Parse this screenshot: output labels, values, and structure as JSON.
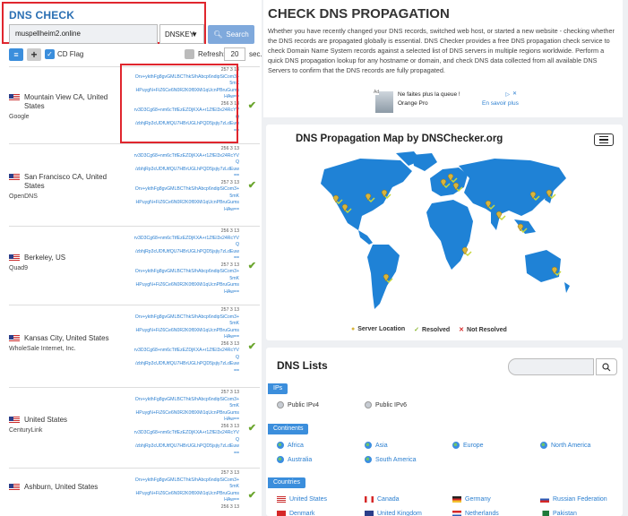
{
  "left": {
    "title": "DNS CHECK",
    "domain_value": "muspellheim2.online",
    "record_type": "DNSKEY",
    "search_label": "Search",
    "cd_flag_label": "CD Flag",
    "refresh_label": "Refresh:",
    "refresh_value": "20",
    "refresh_unit": "sec.",
    "results": [
      {
        "city": "Mountain View CA, United States",
        "provider": "Google",
        "records": [
          "257 3 13",
          "Orv+ykthFg8gvGMLBCThkS/hAbcp6ndipSiCom3+",
          "5mK",
          "HPuygN+FiZ6Ce6N0R2K0f8XMi1qUcnPBruGums",
          "HAw==",
          "256 3 13",
          "rv3D3Cg68+nm6cTtfEzEZDjKXA+r1ZfEl3x24RcYV",
          "Q",
          "/zbhjRp3cUDfUtfQU7HBrUGLhPQD5jsjiy7zLdEuw",
          "=="
        ]
      },
      {
        "city": "San Francisco CA, United States",
        "provider": "OpenDNS",
        "records": [
          "256 3 13",
          "rv3D3Cg68+nm6cTtfEzEZDjKXA+r1ZfEl3x24RcYV",
          "Q",
          "/zbhjRp3cUDfUtfQU7HBrUGLhPQD5jsjiy7zLdEuw",
          "==",
          "257 3 13",
          "Orv+ykthFg8gvGMLBCThkS/hAbcp6ndipSiCom3+",
          "5mK",
          "HPuygN+FiZ6Ce6N0R2K0f8XMi1qUcnPBruGums",
          "HAw=="
        ]
      },
      {
        "city": "Berkeley, US",
        "provider": "Quad9",
        "records": [
          "256 3 13",
          "rv3D3Cg68+nm6cTtfEzEZDjKXA+r1ZfEl3x24RcYV",
          "Q",
          "/zbhjRp3cUDfUtfQU7HBrUGLhPQD5jsjiy7zLdEuw",
          "==",
          "257 3 13",
          "Orv+ykthFg8gvGMLBCThkS/hAbcp6ndipSiCom3+",
          "5mK",
          "HPuygN+FiZ6Ce6N0R2K0f8XMi1qUcnPBruGums",
          "HAw=="
        ]
      },
      {
        "city": "Kansas City, United States",
        "provider": "WholeSale Internet, Inc.",
        "records": [
          "257 3 13",
          "Orv+ykthFg8gvGMLBCThkS/hAbcp6ndipSiCom3+",
          "5mK",
          "HPuygN+FiZ6Ce6N0R2K0f8XMi1qUcnPBruGums",
          "HAw==",
          "256 3 13",
          "rv3D3Cg68+nm6cTtfEzEZDjKXA+r1ZfEl3x24RcYV",
          "Q",
          "/zbhjRp3cUDfUtfQU7HBrUGLhPQD5jsjiy7zLdEuw",
          "=="
        ]
      },
      {
        "city": "United States",
        "provider": "CenturyLink",
        "records": [
          "257 3 13",
          "Orv+ykthFg8gvGMLBCThkS/hAbcp6ndipSiCom3+",
          "5mK",
          "HPuygN+FiZ6Ce6N0R2K0f8XMi1qUcnPBruGums",
          "HAw==",
          "256 3 13",
          "rv3D3Cg68+nm6cTtfEzEZDjKXA+r1ZfEl3x24RcYV",
          "Q",
          "/zbhjRp3cUDfUtfQU7HBrUGLhPQD5jsjiy7zLdEuw",
          "=="
        ]
      },
      {
        "city": "Ashburn, United States",
        "provider": "",
        "records": [
          "257 3 13",
          "Orv+ykthFg8gvGMLBCThkS/hAbcp6ndipSiCom3+",
          "5mK",
          "HPuygN+FiZ6Ce6N0R2K0f8XMi1qUcnPBruGums",
          "HAw==",
          "256 3 13"
        ]
      }
    ]
  },
  "right": {
    "title": "CHECK DNS PROPAGATION",
    "description": "Whether you have recently changed your DNS records, switched web host, or started a new website - checking whether the DNS records are propagated globally is essential. DNS Checker provides a free DNS propagation check service to check Domain Name System records against a selected list of DNS servers in multiple regions worldwide. Perform a quick DNS propagation lookup for any hostname or domain, and check DNS data collected from all available DNS Servers to confirm that the DNS records are fully propagated.",
    "ad": {
      "label": "Ad",
      "title": "Ne faites plus la queue !",
      "brand": "Orange Pro",
      "cta": "En savoir plus"
    },
    "map": {
      "title": "DNS Propagation Map by DNSChecker.org",
      "legend_server": "Server Location",
      "legend_resolved": "Resolved",
      "legend_not_resolved": "Not Resolved"
    },
    "lists": {
      "title": "DNS Lists",
      "ips_tag": "IPs",
      "ipv4": "Public IPv4",
      "ipv6": "Public IPv6",
      "continents_tag": "Continents",
      "continents": [
        "Africa",
        "Asia",
        "Europe",
        "North America",
        "Australia",
        "South America"
      ],
      "countries_tag": "Countries",
      "countries": [
        "United States",
        "Canada",
        "Germany",
        "Russian Federation",
        "Denmark",
        "United Kingdom",
        "Netherlands",
        "Pakistan"
      ]
    }
  },
  "colors": {
    "accent": "#2a6fb3",
    "link": "#2b7fd0",
    "resolved": "#6aa52d",
    "highlight": "#e0262e",
    "map_land": "#1f82d6"
  }
}
